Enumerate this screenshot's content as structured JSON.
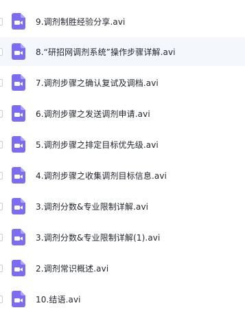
{
  "icon_color": "#7b6cf3",
  "hover_row_index": 1,
  "files": [
    {
      "name": "9.调剂制胜经验分享.avi",
      "icon": "video-file-icon"
    },
    {
      "name": "8.“研招网调剂系统”操作步骤详解.avi",
      "icon": "video-file-icon"
    },
    {
      "name": "7.调剂步骤之确认复试及调档.avi",
      "icon": "video-file-icon"
    },
    {
      "name": "6.调剂步骤之发送调剂申请.avi",
      "icon": "video-file-icon"
    },
    {
      "name": "5.调剂步骤之排定目标优先级.avi",
      "icon": "video-file-icon"
    },
    {
      "name": "4.调剂步骤之收集调剂目标信息.avi",
      "icon": "video-file-icon"
    },
    {
      "name": "3.调剂分数&专业限制详解.avi",
      "icon": "video-file-icon"
    },
    {
      "name": "3.调剂分数&专业限制详解(1).avi",
      "icon": "video-file-icon"
    },
    {
      "name": "2.调剂常识概述.avi",
      "icon": "video-file-icon"
    },
    {
      "name": "10.结语.avi",
      "icon": "video-file-icon"
    }
  ]
}
